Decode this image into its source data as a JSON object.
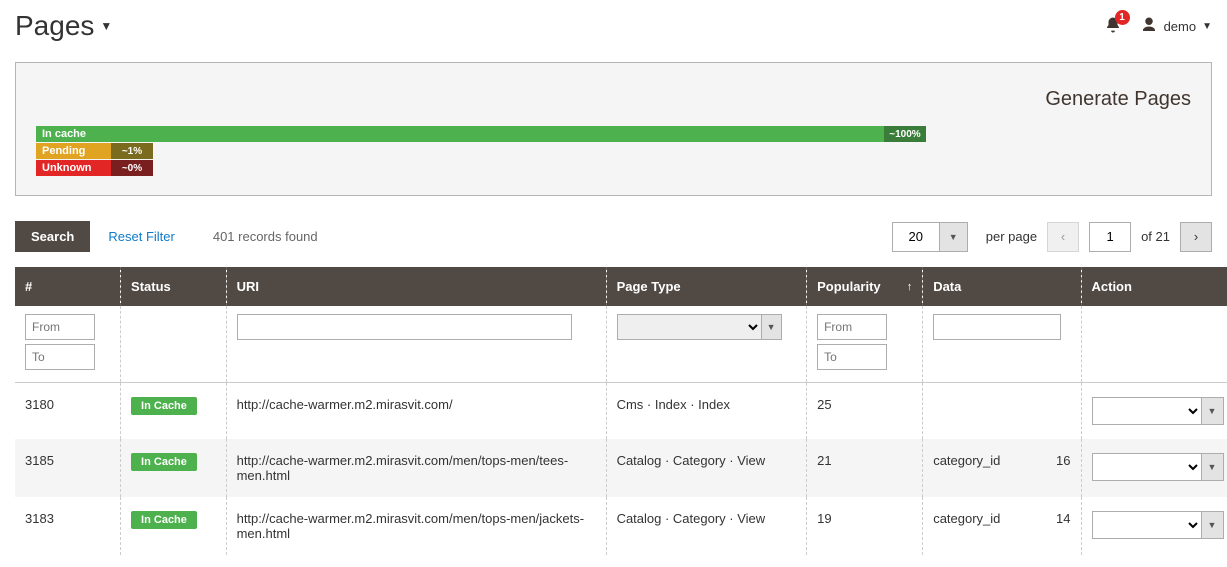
{
  "header": {
    "title": "Pages",
    "notif_count": "1",
    "user_name": "demo"
  },
  "generate_panel": {
    "link_label": "Generate Pages",
    "bars": {
      "in_cache": {
        "label": "In cache",
        "pct": "~100%"
      },
      "pending": {
        "label": "Pending",
        "pct": "~1%"
      },
      "unknown": {
        "label": "Unknown",
        "pct": "~0%"
      }
    }
  },
  "controls": {
    "search_label": "Search",
    "reset_label": "Reset Filter",
    "records_text": "401 records found",
    "per_page_value": "20",
    "per_page_label": "per page",
    "page_value": "1",
    "of_text": "of 21"
  },
  "table": {
    "headers": {
      "id": "#",
      "status": "Status",
      "uri": "URI",
      "page_type": "Page Type",
      "popularity": "Popularity",
      "data": "Data",
      "action": "Action"
    },
    "filters": {
      "from_placeholder": "From",
      "to_placeholder": "To"
    },
    "rows": [
      {
        "id": "3180",
        "status": "In Cache",
        "uri": "http://cache-warmer.m2.mirasvit.com/",
        "page_type": "Cms · Index · Index",
        "popularity": "25",
        "data_key": "",
        "data_val": ""
      },
      {
        "id": "3185",
        "status": "In Cache",
        "uri": "http://cache-warmer.m2.mirasvit.com/men/tops-men/tees-men.html",
        "page_type": "Catalog · Category · View",
        "popularity": "21",
        "data_key": "category_id",
        "data_val": "16"
      },
      {
        "id": "3183",
        "status": "In Cache",
        "uri": "http://cache-warmer.m2.mirasvit.com/men/tops-men/jackets-men.html",
        "page_type": "Catalog · Category · View",
        "popularity": "19",
        "data_key": "category_id",
        "data_val": "14"
      }
    ]
  }
}
